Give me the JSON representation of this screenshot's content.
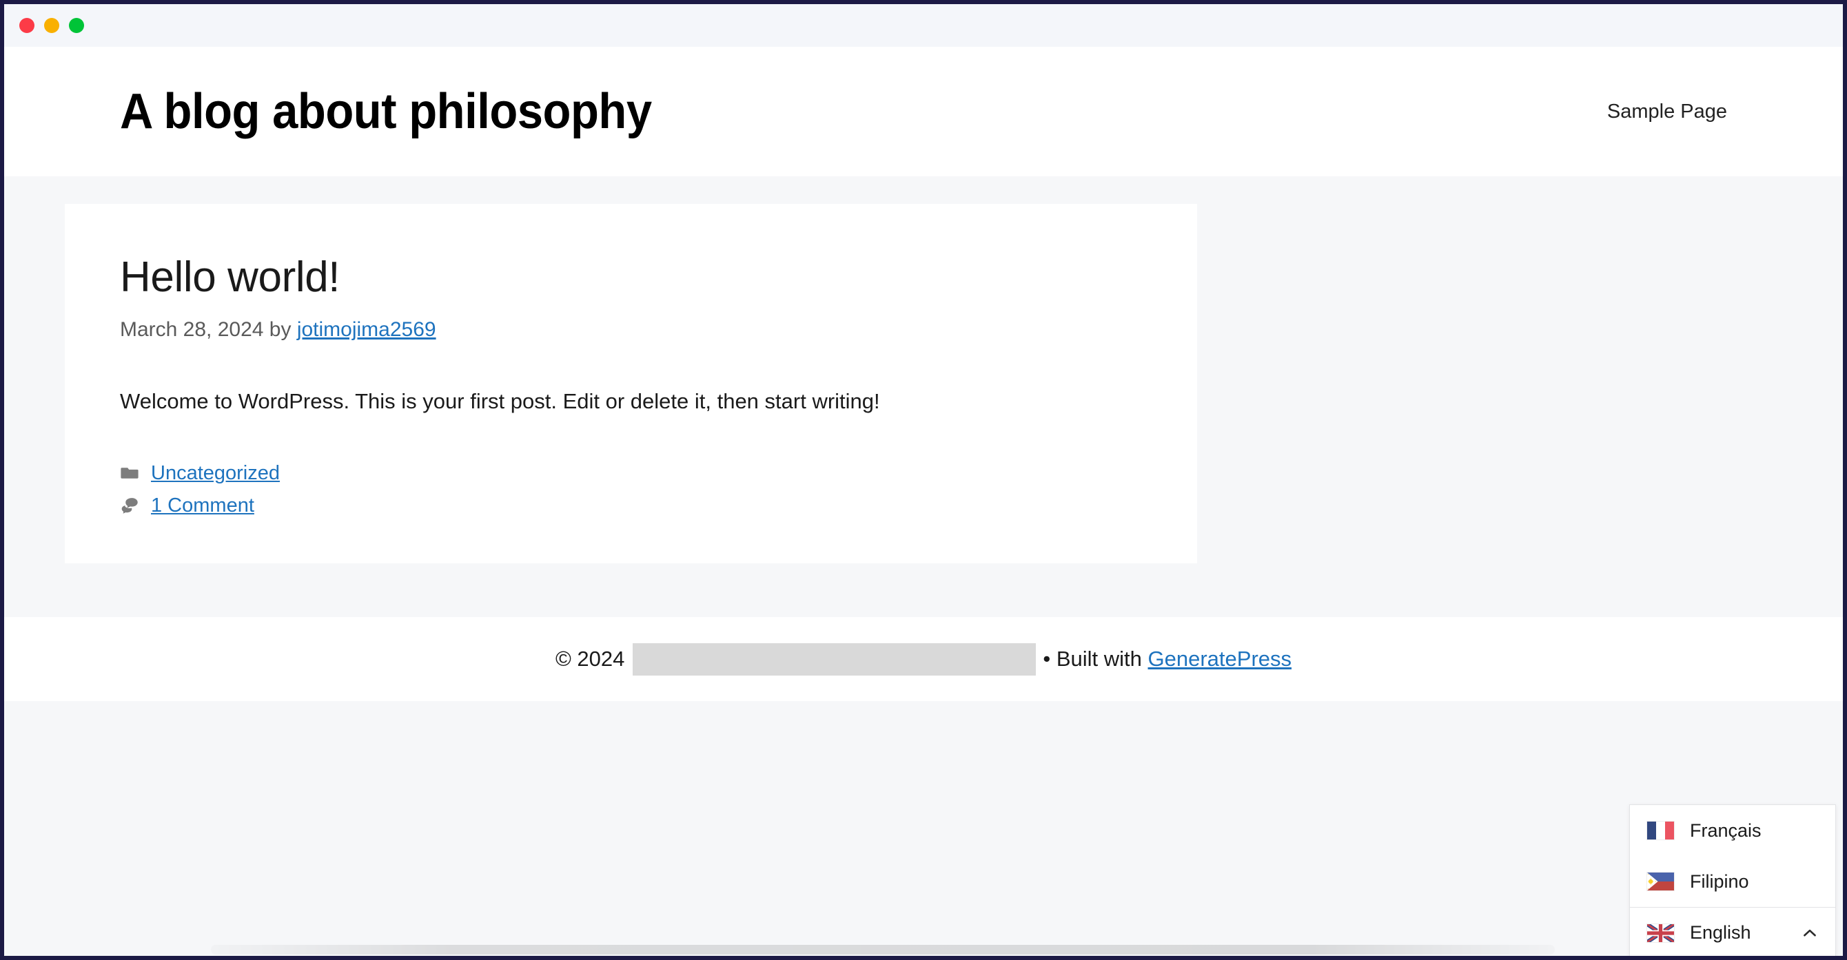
{
  "window": {
    "traffic_lights": [
      {
        "name": "close",
        "color": "#fc3b47"
      },
      {
        "name": "minimize",
        "color": "#f9b000"
      },
      {
        "name": "maximize",
        "color": "#00c437"
      }
    ]
  },
  "header": {
    "site_title": "A blog about philosophy",
    "nav": [
      {
        "label": "Sample Page"
      }
    ]
  },
  "post": {
    "title": "Hello world!",
    "meta_date": "March 28, 2024",
    "meta_by": " by ",
    "author": "jotimojima2569",
    "body": "Welcome to WordPress. This is your first post. Edit or delete it, then start writing!",
    "category_icon": "folder-icon",
    "category": "Uncategorized",
    "comments_icon": "comments-icon",
    "comments": "1 Comment"
  },
  "footer": {
    "copyright": "© 2024",
    "redacted": "",
    "built_with": "• Built with ",
    "theme_link": "GeneratePress"
  },
  "language_switcher": {
    "items": [
      {
        "label": "Français",
        "flag": "flag-france-icon",
        "current": false
      },
      {
        "label": "Filipino",
        "flag": "flag-philippines-icon",
        "current": false
      },
      {
        "label": "English",
        "flag": "flag-united-kingdom-icon",
        "current": true
      }
    ],
    "toggle_icon": "chevron-up-icon"
  },
  "colors": {
    "link": "#1e73be",
    "page_background": "#f6f7f9",
    "card_background": "#ffffff",
    "window_border": "#1c1a45",
    "redacted_block": "#d9d9d9"
  }
}
